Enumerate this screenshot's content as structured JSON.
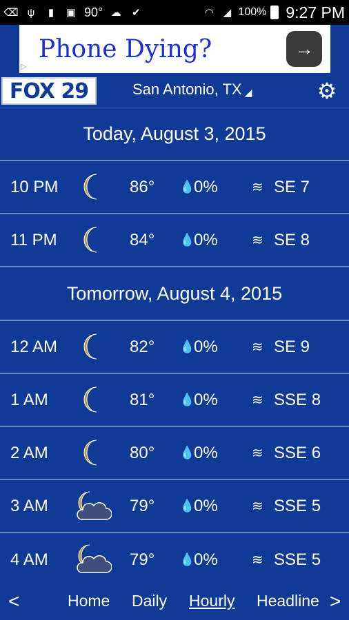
{
  "statusbar": {
    "temp": "90°",
    "battery_pct": "100%",
    "time": "9:27 PM"
  },
  "ad": {
    "title": "Phone Dying?",
    "button": "→"
  },
  "header": {
    "logo": "FOX 29",
    "city": "San Antonio, TX",
    "city_caret": "◢"
  },
  "days": [
    {
      "label": "Today, August 3, 2015"
    },
    {
      "label": "Tomorrow, August 4, 2015"
    }
  ],
  "rows": [
    {
      "time": "10 PM",
      "icon": "moon-icon",
      "temp": "86°",
      "precip": "0%",
      "wind": "SE 7"
    },
    {
      "time": "11 PM",
      "icon": "moon-icon",
      "temp": "84°",
      "precip": "0%",
      "wind": "SE 8"
    },
    {
      "time": "12 AM",
      "icon": "moon-icon",
      "temp": "82°",
      "precip": "0%",
      "wind": "SE 9"
    },
    {
      "time": "1 AM",
      "icon": "moon-icon",
      "temp": "81°",
      "precip": "0%",
      "wind": "SSE 8"
    },
    {
      "time": "2 AM",
      "icon": "moon-icon",
      "temp": "80°",
      "precip": "0%",
      "wind": "SSE 6"
    },
    {
      "time": "3 AM",
      "icon": "moon-cloud-icon",
      "temp": "79°",
      "precip": "0%",
      "wind": "SSE 5"
    },
    {
      "time": "4 AM",
      "icon": "moon-cloud-icon",
      "temp": "79°",
      "precip": "0%",
      "wind": "SSE 5"
    }
  ],
  "nav": {
    "left": "<",
    "right": ">",
    "items": [
      "Home",
      "Daily",
      "Hourly",
      "Headline"
    ]
  },
  "colors": {
    "background": "#0f3a95",
    "divider": "#6a86c4",
    "moon": "#c39a3b",
    "cloud": "#3d4f7a"
  }
}
